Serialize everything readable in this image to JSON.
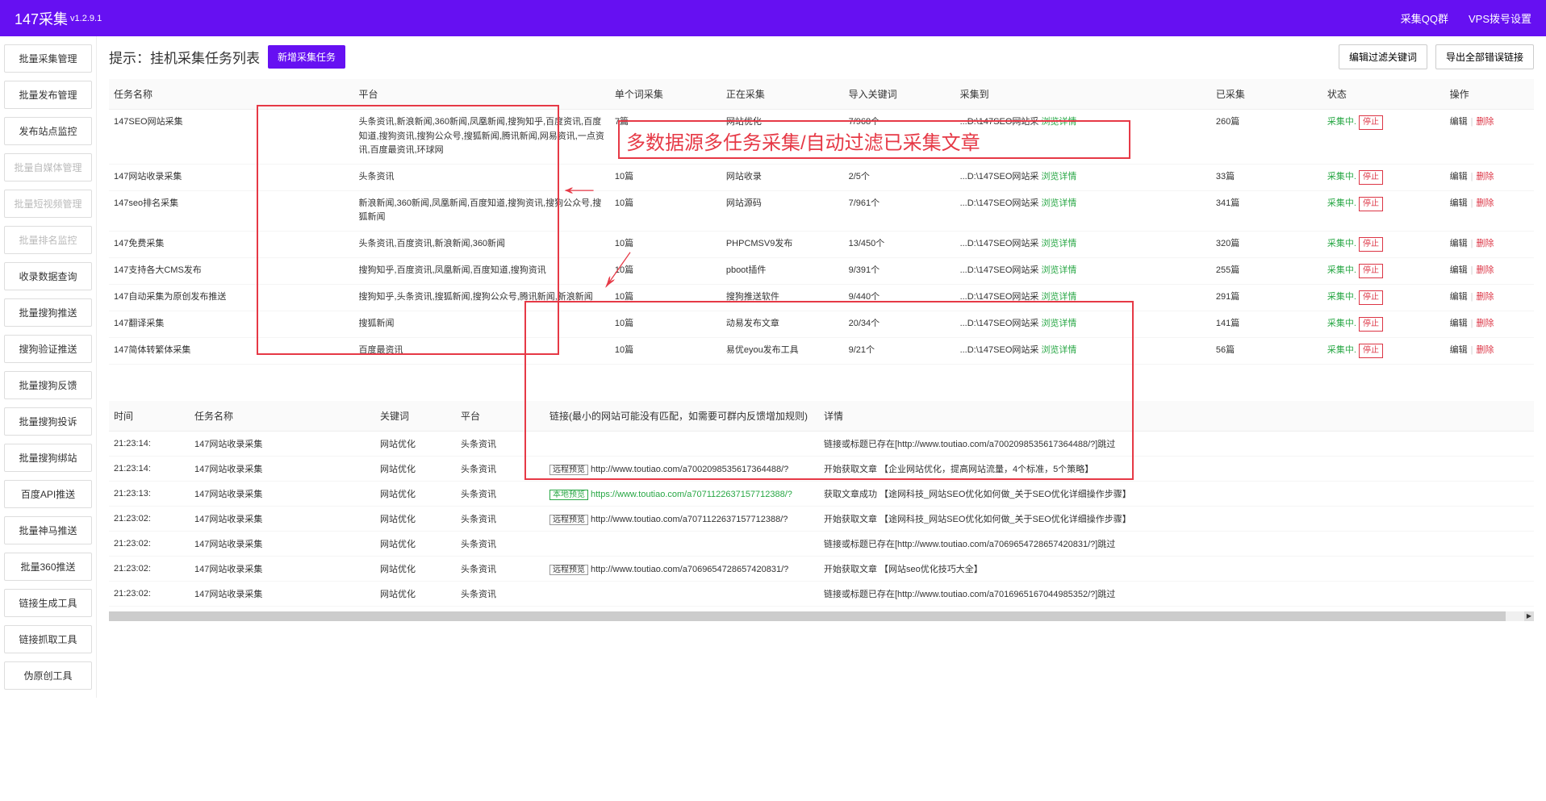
{
  "header": {
    "title": "147采集",
    "version": "v1.2.9.1",
    "links": {
      "qq": "采集QQ群",
      "vps": "VPS拨号设置"
    }
  },
  "sidebar": {
    "items": [
      {
        "label": "批量采集管理",
        "disabled": false
      },
      {
        "label": "批量发布管理",
        "disabled": false
      },
      {
        "label": "发布站点监控",
        "disabled": false
      },
      {
        "label": "批量自媒体管理",
        "disabled": true
      },
      {
        "label": "批量短视频管理",
        "disabled": true
      },
      {
        "label": "批量排名监控",
        "disabled": true
      },
      {
        "label": "收录数据查询",
        "disabled": false
      },
      {
        "label": "批量搜狗推送",
        "disabled": false
      },
      {
        "label": "搜狗验证推送",
        "disabled": false
      },
      {
        "label": "批量搜狗反馈",
        "disabled": false
      },
      {
        "label": "批量搜狗投诉",
        "disabled": false
      },
      {
        "label": "批量搜狗绑站",
        "disabled": false
      },
      {
        "label": "百度API推送",
        "disabled": false
      },
      {
        "label": "批量神马推送",
        "disabled": false
      },
      {
        "label": "批量360推送",
        "disabled": false
      },
      {
        "label": "链接生成工具",
        "disabled": false
      },
      {
        "label": "链接抓取工具",
        "disabled": false
      },
      {
        "label": "伪原创工具",
        "disabled": false
      }
    ]
  },
  "titleRow": {
    "title": "提示：挂机采集任务列表",
    "addBtn": "新增采集任务",
    "filterBtn": "编辑过滤关键词",
    "exportBtn": "导出全部错误链接"
  },
  "annotation": "多数据源多任务采集/自动过滤已采集文章",
  "taskTable": {
    "headers": {
      "name": "任务名称",
      "platform": "平台",
      "single": "单个词采集",
      "collecting": "正在采集",
      "keyword": "导入关键词",
      "target": "采集到",
      "count": "已采集",
      "status": "状态",
      "op": "操作"
    },
    "viewDetail": "浏览详情",
    "statusText": "采集中.",
    "stopBtn": "停止",
    "editBtn": "编辑",
    "delBtn": "删除",
    "rows": [
      {
        "name": "147SEO网站采集",
        "platform": "头条资讯,新浪新闻,360新闻,凤凰新闻,搜狗知乎,百度资讯,百度知道,搜狗资讯,搜狗公众号,搜狐新闻,腾讯新闻,网易资讯,一点资讯,百度最资讯,环球网",
        "single": "7篇",
        "collecting": "网站优化",
        "keyword": "7/968个",
        "target": "...D:\\147SEO网站采",
        "count": "260篇"
      },
      {
        "name": "147网站收录采集",
        "platform": "头条资讯",
        "single": "10篇",
        "collecting": "网站收录",
        "keyword": "2/5个",
        "target": "...D:\\147SEO网站采",
        "count": "33篇"
      },
      {
        "name": "147seo排名采集",
        "platform": "新浪新闻,360新闻,凤凰新闻,百度知道,搜狗资讯,搜狗公众号,搜狐新闻",
        "single": "10篇",
        "collecting": "网站源码",
        "keyword": "7/961个",
        "target": "...D:\\147SEO网站采",
        "count": "341篇"
      },
      {
        "name": "147免费采集",
        "platform": "头条资讯,百度资讯,新浪新闻,360新闻",
        "single": "10篇",
        "collecting": "PHPCMSV9发布",
        "keyword": "13/450个",
        "target": "...D:\\147SEO网站采",
        "count": "320篇"
      },
      {
        "name": "147支持各大CMS发布",
        "platform": "搜狗知乎,百度资讯,凤凰新闻,百度知道,搜狗资讯",
        "single": "10篇",
        "collecting": "pboot插件",
        "keyword": "9/391个",
        "target": "...D:\\147SEO网站采",
        "count": "255篇"
      },
      {
        "name": "147自动采集为原创发布推送",
        "platform": "搜狗知乎,头条资讯,搜狐新闻,搜狗公众号,腾讯新闻,新浪新闻",
        "single": "10篇",
        "collecting": "搜狗推送软件",
        "keyword": "9/440个",
        "target": "...D:\\147SEO网站采",
        "count": "291篇"
      },
      {
        "name": "147翻译采集",
        "platform": "搜狐新闻",
        "single": "10篇",
        "collecting": "动易发布文章",
        "keyword": "20/34个",
        "target": "...D:\\147SEO网站采",
        "count": "141篇"
      },
      {
        "name": "147简体转繁体采集",
        "platform": "百度最资讯",
        "single": "10篇",
        "collecting": "易优eyou发布工具",
        "keyword": "9/21个",
        "target": "...D:\\147SEO网站采",
        "count": "56篇"
      }
    ]
  },
  "logTable": {
    "headers": {
      "time": "时间",
      "task": "任务名称",
      "keyword": "关键词",
      "platform": "平台",
      "link": "链接(最小的网站可能没有匹配，如需要可群内反馈增加规则)",
      "detail": "详情"
    },
    "tagRemote": "远程预览",
    "tagLocal": "本地预览",
    "rows": [
      {
        "time": "21:23:14:",
        "task": "147网站收录采集",
        "keyword": "网站优化",
        "platform": "头条资讯",
        "linkType": "",
        "url": "",
        "detail": "链接或标题已存在[http://www.toutiao.com/a7002098535617364488/?]跳过"
      },
      {
        "time": "21:23:14:",
        "task": "147网站收录采集",
        "keyword": "网站优化",
        "platform": "头条资讯",
        "linkType": "remote",
        "url": "http://www.toutiao.com/a7002098535617364488/?",
        "detail": "开始获取文章 【企业网站优化，提高网站流量，4个标准，5个策略】"
      },
      {
        "time": "21:23:13:",
        "task": "147网站收录采集",
        "keyword": "网站优化",
        "platform": "头条资讯",
        "linkType": "local",
        "url": "https://www.toutiao.com/a7071122637157712388/?",
        "detail": "获取文章成功 【途网科技_网站SEO优化如何做_关于SEO优化详细操作步骤】"
      },
      {
        "time": "21:23:02:",
        "task": "147网站收录采集",
        "keyword": "网站优化",
        "platform": "头条资讯",
        "linkType": "remote",
        "url": "http://www.toutiao.com/a7071122637157712388/?",
        "detail": "开始获取文章 【途网科技_网站SEO优化如何做_关于SEO优化详细操作步骤】"
      },
      {
        "time": "21:23:02:",
        "task": "147网站收录采集",
        "keyword": "网站优化",
        "platform": "头条资讯",
        "linkType": "",
        "url": "",
        "detail": "链接或标题已存在[http://www.toutiao.com/a7069654728657420831/?]跳过"
      },
      {
        "time": "21:23:02:",
        "task": "147网站收录采集",
        "keyword": "网站优化",
        "platform": "头条资讯",
        "linkType": "remote",
        "url": "http://www.toutiao.com/a7069654728657420831/?",
        "detail": "开始获取文章 【网站seo优化技巧大全】"
      },
      {
        "time": "21:23:02:",
        "task": "147网站收录采集",
        "keyword": "网站优化",
        "platform": "头条资讯",
        "linkType": "",
        "url": "",
        "detail": "链接或标题已存在[http://www.toutiao.com/a7016965167044985352/?]跳过"
      }
    ]
  }
}
